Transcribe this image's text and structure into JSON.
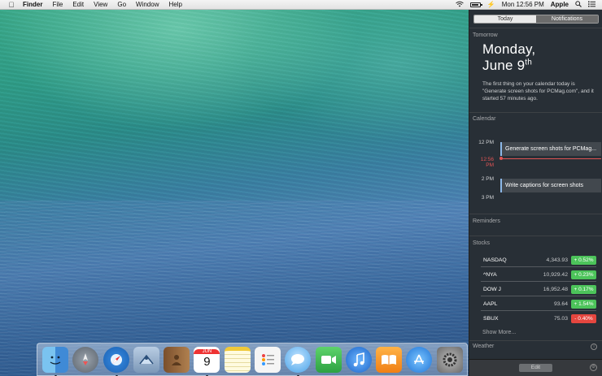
{
  "menubar": {
    "apple_icon": "apple-icon",
    "items": [
      "Finder",
      "File",
      "Edit",
      "View",
      "Go",
      "Window",
      "Help"
    ],
    "clock": "Mon 12:56 PM",
    "user": "Apple",
    "status_icons": [
      "wifi-icon",
      "battery-icon",
      "charging-icon",
      "search-icon",
      "list-icon"
    ]
  },
  "notification_center": {
    "tabs": [
      {
        "label": "Today",
        "active": true
      },
      {
        "label": "Notifications",
        "active": false
      }
    ],
    "tomorrow": {
      "header": "Tomorrow",
      "day": "Monday,",
      "date": "June 9",
      "date_suffix": "th",
      "summary": "The first thing on your calendar today is \"Generate screen shots for PCMag.com\", and it started 57 minutes ago."
    },
    "calendar": {
      "header": "Calendar",
      "times": [
        "12 PM",
        "12:56 PM",
        "2 PM",
        "3 PM"
      ],
      "events": [
        "Generate screen shots for PCMag...",
        "Write captions for screen shots"
      ]
    },
    "reminders": {
      "header": "Reminders"
    },
    "stocks": {
      "header": "Stocks",
      "rows": [
        {
          "symbol": "NASDAQ",
          "price": "4,343.93",
          "change": "+ 0.52%",
          "direction": "up"
        },
        {
          "symbol": "^NYA",
          "price": "10,929.42",
          "change": "+ 0.23%",
          "direction": "up"
        },
        {
          "symbol": "DOW J",
          "price": "16,952.48",
          "change": "+ 0.17%",
          "direction": "up"
        },
        {
          "symbol": "AAPL",
          "price": "93.64",
          "change": "+ 1.54%",
          "direction": "up"
        },
        {
          "symbol": "SBUX",
          "price": "75.03",
          "change": "- 0.40%",
          "direction": "down"
        }
      ],
      "show_more": "Show More..."
    },
    "weather": {
      "header": "Weather"
    },
    "footer": {
      "edit_label": "Edit"
    }
  },
  "dock": {
    "calendar_month": "JUN",
    "calendar_day": "9",
    "apps": [
      "finder",
      "launchpad",
      "safari",
      "mail",
      "contacts",
      "calendar",
      "notes",
      "reminders",
      "messages",
      "facetime",
      "itunes",
      "ibooks",
      "app-store",
      "system-preferences"
    ]
  }
}
